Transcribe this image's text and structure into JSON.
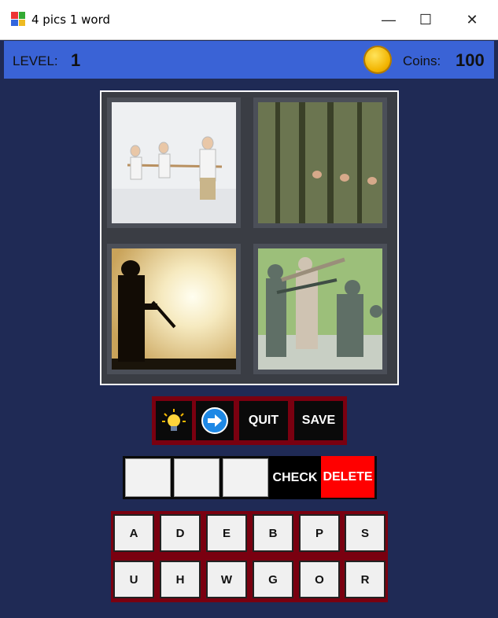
{
  "window": {
    "title": "4 pics 1 word",
    "minimize_glyph": "—",
    "maximize_glyph": "☐",
    "close_glyph": "✕"
  },
  "header": {
    "level_label": "LEVEL:",
    "level_value": "1",
    "coins_label": "Coins:",
    "coins_value": "100"
  },
  "pictures": [
    {
      "name": "tug-of-war-kids"
    },
    {
      "name": "soldiers-in-line"
    },
    {
      "name": "soldier-silhouette-sunset"
    },
    {
      "name": "toy-army-men"
    }
  ],
  "toolbar": {
    "hint_icon": "lightbulb-icon",
    "next_icon": "arrow-right-icon",
    "quit_label": "QUIT",
    "save_label": "SAVE"
  },
  "answer": {
    "slots": [
      "",
      "",
      ""
    ],
    "check_label": "CHECK",
    "delete_label": "DELETE"
  },
  "keyboard": {
    "row1": [
      "A",
      "D",
      "E",
      "B",
      "P",
      "S"
    ],
    "row2": [
      "U",
      "H",
      "W",
      "G",
      "O",
      "R"
    ]
  },
  "colors": {
    "background": "#1f2a55",
    "header": "#3a63d6",
    "frame": "#7a0010",
    "delete": "#ff0000",
    "coin": "#f2b400"
  }
}
